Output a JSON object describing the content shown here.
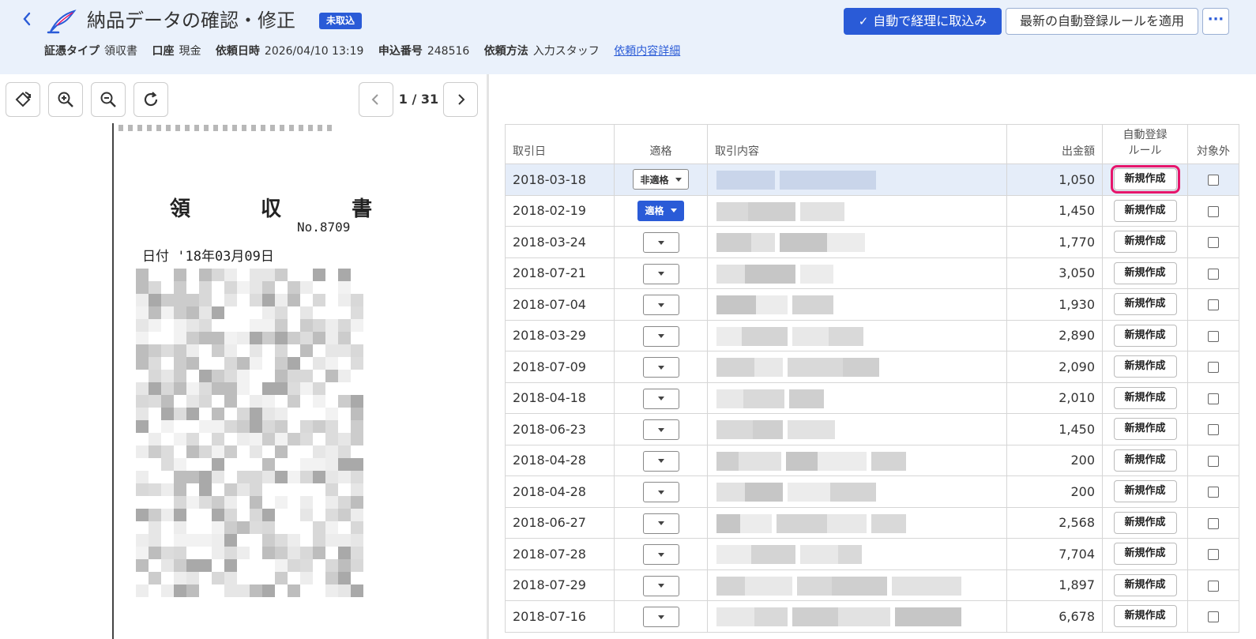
{
  "header": {
    "back_icon": "chevron-left-icon",
    "logo_icon": "quill-logo-icon",
    "title": "納品データの確認・修正",
    "status_badge": "未取込",
    "meta": [
      {
        "label": "証憑タイプ",
        "value": "領収書"
      },
      {
        "label": "口座",
        "value": "現金"
      },
      {
        "label": "依頼日時",
        "value": "2026/04/10 13:19"
      },
      {
        "label": "申込番号",
        "value": "248516"
      },
      {
        "label": "依頼方法",
        "value": "入力スタッフ"
      }
    ],
    "detail_link": "依頼内容詳細",
    "primary_button": "自動で経理に取込み",
    "secondary_button": "最新の自動登録ルールを適用",
    "more_button": "···"
  },
  "viewer": {
    "tools": [
      "rotate-icon",
      "zoom-in-icon",
      "zoom-out-icon",
      "refresh-icon"
    ],
    "page": "1 / 31",
    "receipt": {
      "title": "領 収 書",
      "number": "No.8709",
      "date": "日付 '18年03月09日"
    }
  },
  "table": {
    "headers": {
      "date": "取引日",
      "fit": "適格",
      "desc": "取引内容",
      "amount": "出金額",
      "rule_1": "自動登録",
      "rule_2": "ルール",
      "excluded": "対象外"
    },
    "rule_button": "新規作成",
    "fit_options": {
      "non": "非適格",
      "yes": "適格"
    },
    "rows": [
      {
        "date": "2018-03-18",
        "fit": "非適格",
        "amount": "1,050",
        "selected": true
      },
      {
        "date": "2018-02-19",
        "fit": "適格",
        "amount": "1,450"
      },
      {
        "date": "2018-03-24",
        "fit": "",
        "amount": "1,770"
      },
      {
        "date": "2018-07-21",
        "fit": "",
        "amount": "3,050"
      },
      {
        "date": "2018-07-04",
        "fit": "",
        "amount": "1,930"
      },
      {
        "date": "2018-03-29",
        "fit": "",
        "amount": "2,890"
      },
      {
        "date": "2018-07-09",
        "fit": "",
        "amount": "2,090"
      },
      {
        "date": "2018-04-18",
        "fit": "",
        "amount": "2,010"
      },
      {
        "date": "2018-06-23",
        "fit": "",
        "amount": "1,450"
      },
      {
        "date": "2018-04-28",
        "fit": "",
        "amount": "200"
      },
      {
        "date": "2018-04-28",
        "fit": "",
        "amount": "200"
      },
      {
        "date": "2018-06-27",
        "fit": "",
        "amount": "2,568"
      },
      {
        "date": "2018-07-28",
        "fit": "",
        "amount": "7,704"
      },
      {
        "date": "2018-07-29",
        "fit": "",
        "amount": "1,897"
      },
      {
        "date": "2018-07-16",
        "fit": "",
        "amount": "6,678"
      }
    ]
  },
  "colors": {
    "accent": "#2a5bd7",
    "header_bg": "#eaf1fb",
    "highlight": "#e6156b",
    "selected_row": "#e5edf9"
  }
}
